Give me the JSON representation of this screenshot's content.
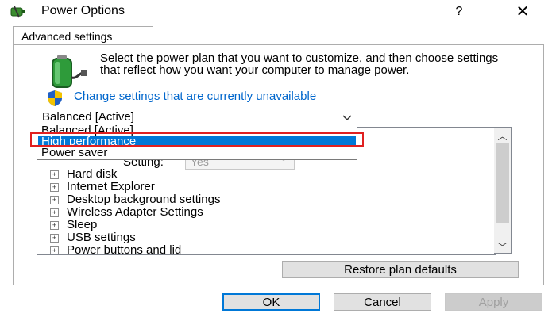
{
  "window": {
    "title": "Power Options",
    "help_label": "?",
    "close_label": "✕"
  },
  "tab": {
    "label": "Advanced settings"
  },
  "description": "Select the power plan that you want to customize, and then choose settings that reflect how you want your computer to manage power.",
  "change_link": "Change settings that are currently unavailable",
  "plan_select": {
    "value": "Balanced [Active]"
  },
  "dropdown_options": [
    {
      "label": "Balanced [Active]",
      "selected": false
    },
    {
      "label": "High performance",
      "selected": true
    },
    {
      "label": "Power saver",
      "selected": false
    }
  ],
  "setting": {
    "label": "Setting:",
    "value": "Yes"
  },
  "tree_items": [
    "Hard disk",
    "Internet Explorer",
    "Desktop background settings",
    "Wireless Adapter Settings",
    "Sleep",
    "USB settings",
    "Power buttons and lid"
  ],
  "buttons": {
    "restore": "Restore plan defaults",
    "ok": "OK",
    "cancel": "Cancel",
    "apply": "Apply"
  },
  "colors": {
    "accent": "#0078d7",
    "highlight": "#e02020",
    "link": "#0066cc"
  },
  "icons": {
    "title": "power-options-icon",
    "battery": "battery-plug-icon",
    "shield": "uac-shield-icon"
  }
}
